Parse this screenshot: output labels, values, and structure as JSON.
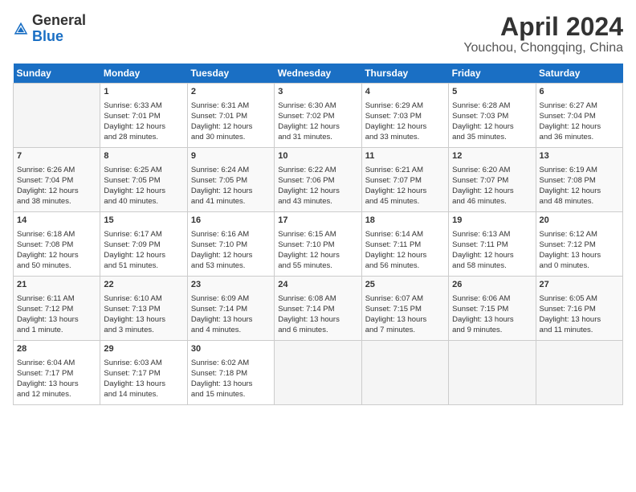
{
  "header": {
    "logo_general": "General",
    "logo_blue": "Blue",
    "month": "April 2024",
    "location": "Youchou, Chongqing, China"
  },
  "weekdays": [
    "Sunday",
    "Monday",
    "Tuesday",
    "Wednesday",
    "Thursday",
    "Friday",
    "Saturday"
  ],
  "weeks": [
    [
      {
        "day": "",
        "info": ""
      },
      {
        "day": "1",
        "info": "Sunrise: 6:33 AM\nSunset: 7:01 PM\nDaylight: 12 hours\nand 28 minutes."
      },
      {
        "day": "2",
        "info": "Sunrise: 6:31 AM\nSunset: 7:01 PM\nDaylight: 12 hours\nand 30 minutes."
      },
      {
        "day": "3",
        "info": "Sunrise: 6:30 AM\nSunset: 7:02 PM\nDaylight: 12 hours\nand 31 minutes."
      },
      {
        "day": "4",
        "info": "Sunrise: 6:29 AM\nSunset: 7:03 PM\nDaylight: 12 hours\nand 33 minutes."
      },
      {
        "day": "5",
        "info": "Sunrise: 6:28 AM\nSunset: 7:03 PM\nDaylight: 12 hours\nand 35 minutes."
      },
      {
        "day": "6",
        "info": "Sunrise: 6:27 AM\nSunset: 7:04 PM\nDaylight: 12 hours\nand 36 minutes."
      }
    ],
    [
      {
        "day": "7",
        "info": "Sunrise: 6:26 AM\nSunset: 7:04 PM\nDaylight: 12 hours\nand 38 minutes."
      },
      {
        "day": "8",
        "info": "Sunrise: 6:25 AM\nSunset: 7:05 PM\nDaylight: 12 hours\nand 40 minutes."
      },
      {
        "day": "9",
        "info": "Sunrise: 6:24 AM\nSunset: 7:05 PM\nDaylight: 12 hours\nand 41 minutes."
      },
      {
        "day": "10",
        "info": "Sunrise: 6:22 AM\nSunset: 7:06 PM\nDaylight: 12 hours\nand 43 minutes."
      },
      {
        "day": "11",
        "info": "Sunrise: 6:21 AM\nSunset: 7:07 PM\nDaylight: 12 hours\nand 45 minutes."
      },
      {
        "day": "12",
        "info": "Sunrise: 6:20 AM\nSunset: 7:07 PM\nDaylight: 12 hours\nand 46 minutes."
      },
      {
        "day": "13",
        "info": "Sunrise: 6:19 AM\nSunset: 7:08 PM\nDaylight: 12 hours\nand 48 minutes."
      }
    ],
    [
      {
        "day": "14",
        "info": "Sunrise: 6:18 AM\nSunset: 7:08 PM\nDaylight: 12 hours\nand 50 minutes."
      },
      {
        "day": "15",
        "info": "Sunrise: 6:17 AM\nSunset: 7:09 PM\nDaylight: 12 hours\nand 51 minutes."
      },
      {
        "day": "16",
        "info": "Sunrise: 6:16 AM\nSunset: 7:10 PM\nDaylight: 12 hours\nand 53 minutes."
      },
      {
        "day": "17",
        "info": "Sunrise: 6:15 AM\nSunset: 7:10 PM\nDaylight: 12 hours\nand 55 minutes."
      },
      {
        "day": "18",
        "info": "Sunrise: 6:14 AM\nSunset: 7:11 PM\nDaylight: 12 hours\nand 56 minutes."
      },
      {
        "day": "19",
        "info": "Sunrise: 6:13 AM\nSunset: 7:11 PM\nDaylight: 12 hours\nand 58 minutes."
      },
      {
        "day": "20",
        "info": "Sunrise: 6:12 AM\nSunset: 7:12 PM\nDaylight: 13 hours\nand 0 minutes."
      }
    ],
    [
      {
        "day": "21",
        "info": "Sunrise: 6:11 AM\nSunset: 7:12 PM\nDaylight: 13 hours\nand 1 minute."
      },
      {
        "day": "22",
        "info": "Sunrise: 6:10 AM\nSunset: 7:13 PM\nDaylight: 13 hours\nand 3 minutes."
      },
      {
        "day": "23",
        "info": "Sunrise: 6:09 AM\nSunset: 7:14 PM\nDaylight: 13 hours\nand 4 minutes."
      },
      {
        "day": "24",
        "info": "Sunrise: 6:08 AM\nSunset: 7:14 PM\nDaylight: 13 hours\nand 6 minutes."
      },
      {
        "day": "25",
        "info": "Sunrise: 6:07 AM\nSunset: 7:15 PM\nDaylight: 13 hours\nand 7 minutes."
      },
      {
        "day": "26",
        "info": "Sunrise: 6:06 AM\nSunset: 7:15 PM\nDaylight: 13 hours\nand 9 minutes."
      },
      {
        "day": "27",
        "info": "Sunrise: 6:05 AM\nSunset: 7:16 PM\nDaylight: 13 hours\nand 11 minutes."
      }
    ],
    [
      {
        "day": "28",
        "info": "Sunrise: 6:04 AM\nSunset: 7:17 PM\nDaylight: 13 hours\nand 12 minutes."
      },
      {
        "day": "29",
        "info": "Sunrise: 6:03 AM\nSunset: 7:17 PM\nDaylight: 13 hours\nand 14 minutes."
      },
      {
        "day": "30",
        "info": "Sunrise: 6:02 AM\nSunset: 7:18 PM\nDaylight: 13 hours\nand 15 minutes."
      },
      {
        "day": "",
        "info": ""
      },
      {
        "day": "",
        "info": ""
      },
      {
        "day": "",
        "info": ""
      },
      {
        "day": "",
        "info": ""
      }
    ]
  ]
}
